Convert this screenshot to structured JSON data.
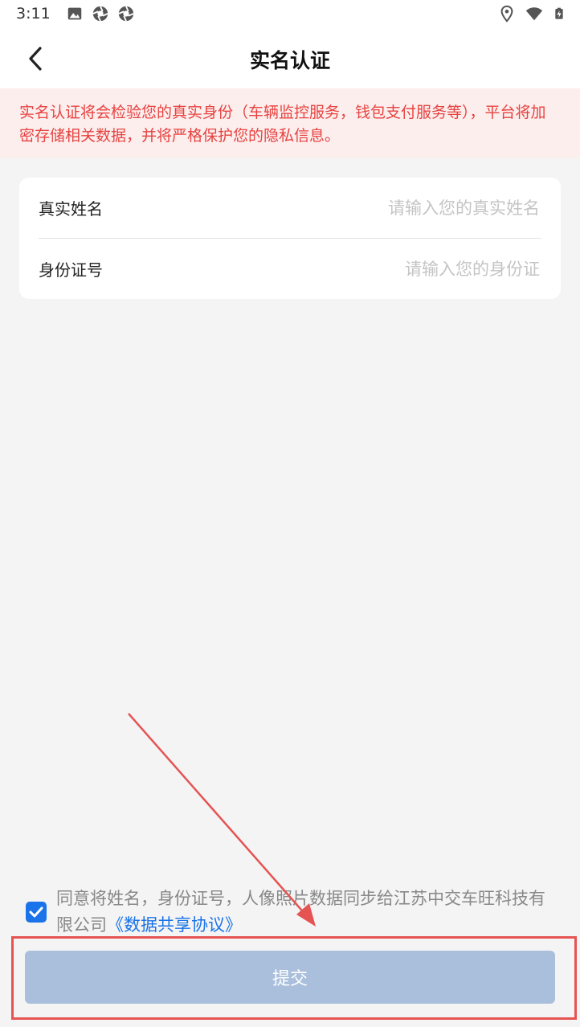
{
  "status_bar": {
    "time": "3:11",
    "left_icons": [
      "image-icon",
      "aperture-icon",
      "aperture-icon"
    ],
    "right_icons": [
      "location-icon",
      "wifi-icon",
      "battery-charging-icon"
    ]
  },
  "header": {
    "back_icon": "chevron-left-icon",
    "title": "实名认证"
  },
  "notice": {
    "text": "实名认证将会检验您的真实身份（车辆监控服务，钱包支付服务等），平台将加密存储相关数据，并将严格保护您的隐私信息。",
    "color": "#e64340",
    "background": "#fdeeee"
  },
  "form": {
    "name_label": "真实姓名",
    "name_value": "",
    "name_placeholder": "请输入您的真实姓名",
    "id_label": "身份证号",
    "id_value": "",
    "id_placeholder": "请输入您的身份证"
  },
  "agreement": {
    "checked": true,
    "text": "同意将姓名，身份证号，人像照片数据同步给江苏中交车旺科技有限公司",
    "link_text": "《数据共享协议》",
    "link_color": "#1a73e8"
  },
  "submit": {
    "label": "提交",
    "background": "#a9bfdc"
  },
  "annotation": {
    "color": "#e55353"
  }
}
